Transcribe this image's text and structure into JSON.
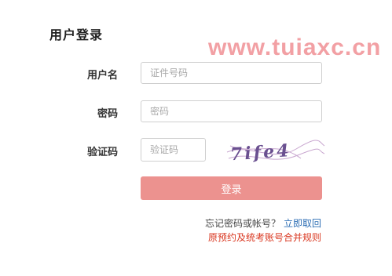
{
  "login": {
    "title": "用户登录",
    "watermark": "www.tuiaxc.cn",
    "username": {
      "label": "用户名",
      "placeholder": "证件号码",
      "value": ""
    },
    "password": {
      "label": "密码",
      "placeholder": "密码",
      "value": ""
    },
    "captcha": {
      "label": "验证码",
      "placeholder": "验证码",
      "value": "",
      "image_text": "7ife4"
    },
    "submit_label": "登录",
    "forgot_text": "忘记密码或帐号？",
    "retrieve_link": "立即取回",
    "merge_rules_link": "原预约及统考账号合并规则"
  },
  "colors": {
    "button_bg": "#ec928f",
    "link_blue": "#2f6fb5",
    "link_red": "#d9361f",
    "watermark": "#f2a0a4"
  }
}
